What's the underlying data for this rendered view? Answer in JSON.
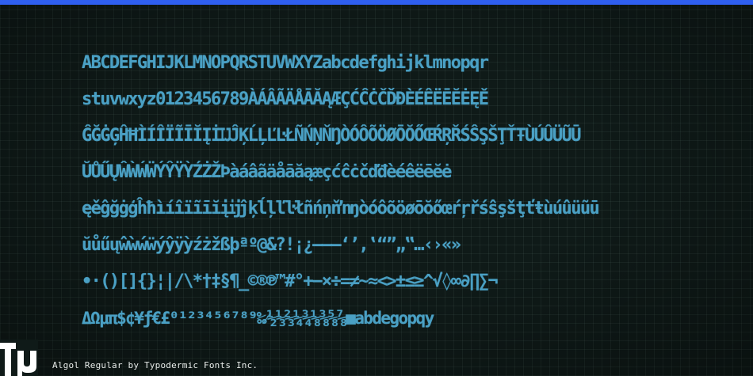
{
  "specimen": {
    "rows": [
      "ABCDEFGHIJKLMNOPQRSTUVWXYZabcdefghijklmnopqr",
      "stuvwxyz0123456789ÀÁÂÃÄÅĀĂĄÆÇĆĈĊČĎĐÈÉÊËĒĔĖĘĚ",
      "ĜĞĠĢĤĦÌÍÎÏĨĪĬĮİĲĴĶĹĻĽĿŁÑŃŅŇŊÒÓÔÕÖØŌŎŐŒŔŖŘŚŜŞŠŢŤŦÙÚÛÜŨŪ",
      "ŬŮŰŲŴẀẂẄÝŶŸỲŹŻŽÞàáâãäåāăąæçćĉċčďđèéêëēĕė",
      "ęěĝğġģĥħìíîïĩīĭįĳĵķĺļľŀłñńņňŉŋòóôõöøōŏőœŕŗřśŝşšţťŧùúûüũū",
      "ŭůűųŵẁẃẅýŷÿỳźżžßþªº@&?!¡¿–—―‘’‚‛“”„‟…‹›«»",
      "•·()[]{}¦|/\\*†‡§¶_©®℗™#°+−×÷=≠~≈<>±≤≥^√◊∞∂∏∑¬",
      "ΔΩμπ$¢¥ƒ€£⁰¹²³⁴⁵⁶⁷⁸⁹‰⁄½⅓⅔¼¾⅛⅜⅝⅞■abdegopqy"
    ]
  },
  "caption": "Algol Regular by Typodermic Fonts Inc.",
  "colors": {
    "accent_bar": "#2f5ff0",
    "glyph": "#4aa0c4",
    "background": "#0f1a18",
    "caption": "#e8ecea"
  },
  "icons": {
    "logo": "typodermic-logo"
  }
}
